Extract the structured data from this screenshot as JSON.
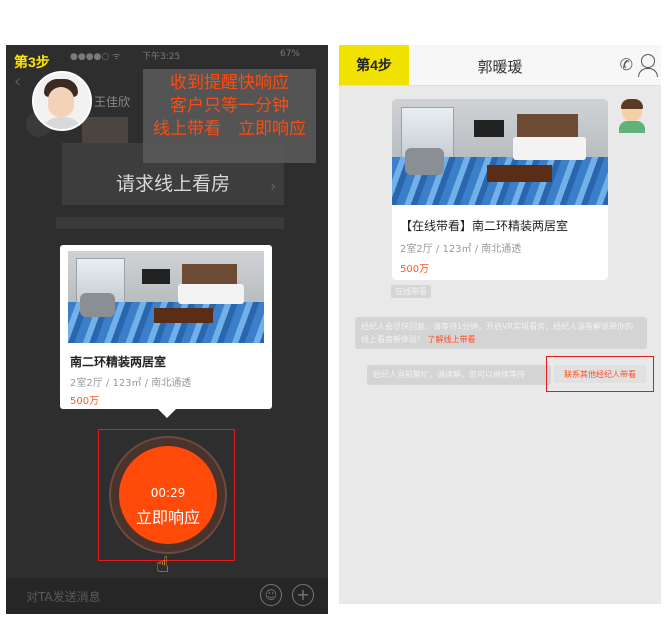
{
  "left_phone": {
    "step_badge": "第3步",
    "status": {
      "signal": "●●●●○  ᯤ",
      "time": "下午3:25",
      "battery": "67%"
    },
    "agent_name": "王佳欣",
    "tip_lines": [
      "收到提醒快响应",
      "客户只等一分钟",
      "线上带看　立即响应"
    ],
    "request_text": "请求线上看房",
    "card": {
      "title": "南二环精装两居室",
      "specs": "2室2厅 / 123㎡ / 南北通透",
      "price": "500万"
    },
    "respond": {
      "timer": "00:29",
      "label": "立即响应"
    },
    "input_placeholder": "对TA发送消息"
  },
  "right_phone": {
    "step_badge": "第4步",
    "title": "郭暖瑗",
    "card": {
      "title": "【在线带看】南二环精装两居室",
      "specs": "2室2厅 / 123㎡ / 南北通透",
      "price": "500万"
    },
    "tag": "在线带看",
    "system_message": "经纪人会尽快回复。请等待1分钟，开启VR实境看房，经纪人语音解说带你的线上看房新体验！",
    "system_link": "了解线上带看",
    "busy_message": "经纪人当前繁忙，请读解，您可以继续等待",
    "contact_button": "联系其他经纪人带看"
  },
  "colors": {
    "accent": "#ff4a0a",
    "highlight_box": "#e51a1a",
    "badge_yellow": "#f1e200"
  }
}
